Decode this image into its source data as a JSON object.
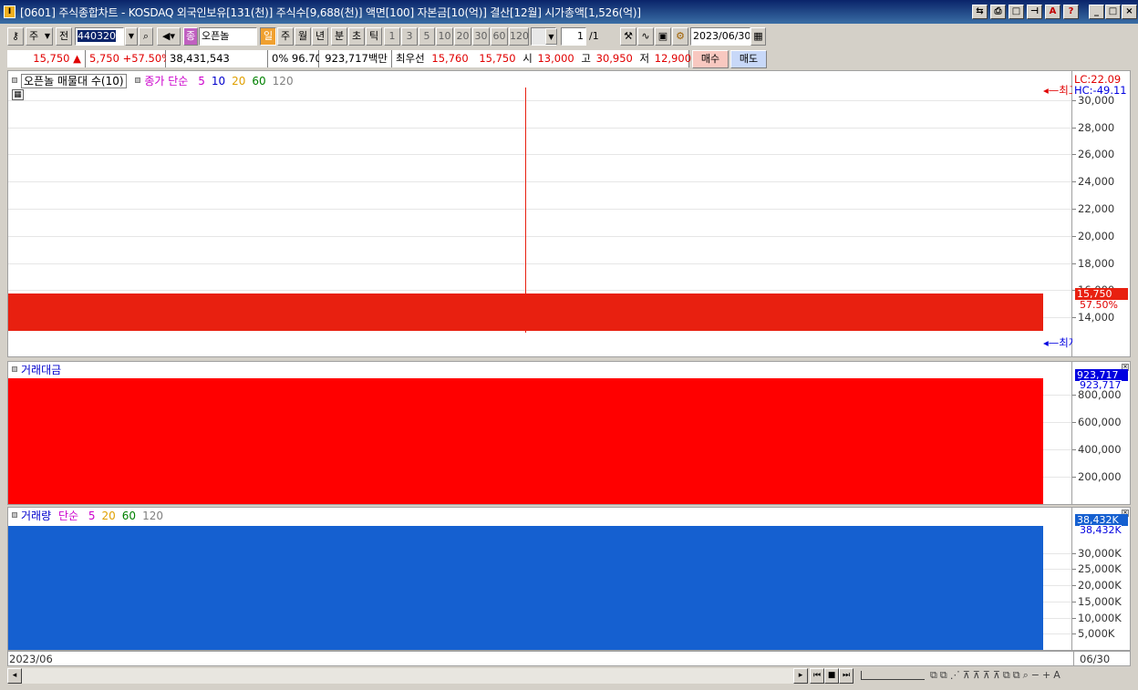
{
  "window": {
    "title": "[0601] 주식종합차트 - KOSDAQ 외국인보유[131(천)] 주식수[9,688(천)] 액면[100] 자본금[10(억)] 결산[12월] 시가총액[1,526(억)]",
    "app_icon": "I"
  },
  "toolbar": {
    "type_select": "주",
    "prev_label": "전",
    "code": "440320",
    "stock_name": "오픈놀",
    "stock_badge": "종",
    "periods": [
      "일",
      "주",
      "월",
      "년",
      "분",
      "초",
      "틱"
    ],
    "active_period": "일",
    "intervals": [
      "1",
      "3",
      "5",
      "10",
      "20",
      "30",
      "60",
      "120"
    ],
    "count": "1",
    "count_total": "/1",
    "date": "2023/06/30"
  },
  "quote": {
    "price": "15,750",
    "change": "5,750",
    "change_pct": "+57.50%",
    "volume": "38,431,543",
    "zero_pct": "0%",
    "ratio": "96.70%",
    "amount": "923,717백만",
    "best_label": "최우선",
    "best_ask": "15,760",
    "best_bid": "15,750",
    "open_label": "시",
    "open": "13,000",
    "high_label": "고",
    "high": "30,950",
    "low_label": "저",
    "low": "12,900",
    "buy_label": "매수",
    "sell_label": "매도"
  },
  "price_panel": {
    "legend_name": "오픈놀 매물대 수(10)",
    "ma_label": "종가 단순",
    "ma_periods": [
      "5",
      "10",
      "20",
      "60",
      "120"
    ],
    "ma_colors": [
      "#cc00cc",
      "#0000cc",
      "#e0a000",
      "#008000",
      "#808080"
    ],
    "ticks": [
      "30,000",
      "28,000",
      "26,000",
      "24,000",
      "22,000",
      "20,000",
      "18,000",
      "16,000",
      "14,000"
    ],
    "lc_text": "LC:22.09",
    "hc_text": "HC:-49.11",
    "high_marker": "최고",
    "low_marker": "최저",
    "price_tag": "15,750",
    "pct_tag": "57.50%",
    "bar_color": "#e82010",
    "wick_color": "#e82010"
  },
  "amount_panel": {
    "legend_name": "거래대금",
    "ticks": [
      "800,000",
      "600,000",
      "400,000",
      "200,000"
    ],
    "value_tag": "923,717",
    "value_text": "923,717",
    "bar_color": "#ff0000"
  },
  "volume_panel": {
    "legend_name": "거래량",
    "ma_label": "단순",
    "ma_periods": [
      "5",
      "20",
      "60",
      "120"
    ],
    "ticks": [
      "30,000K",
      "25,000K",
      "20,000K",
      "15,000K",
      "10,000K",
      "5,000K"
    ],
    "value_tag": "38,432K",
    "value_text": "38,432K",
    "bar_color": "#1560d0"
  },
  "chart_data": {
    "type": "bar",
    "categories": [
      "2023/06/30"
    ],
    "price": {
      "open": 13000,
      "high": 30950,
      "low": 12900,
      "close": 15750,
      "ylim": [
        12000,
        31000
      ]
    },
    "amount": {
      "values": [
        923717
      ],
      "ylim": [
        0,
        950000
      ]
    },
    "volume": {
      "values": [
        38432
      ],
      "ylim": [
        0,
        40000
      ]
    }
  },
  "xaxis": {
    "left_label": "2023/06",
    "right_label": "06/30"
  }
}
